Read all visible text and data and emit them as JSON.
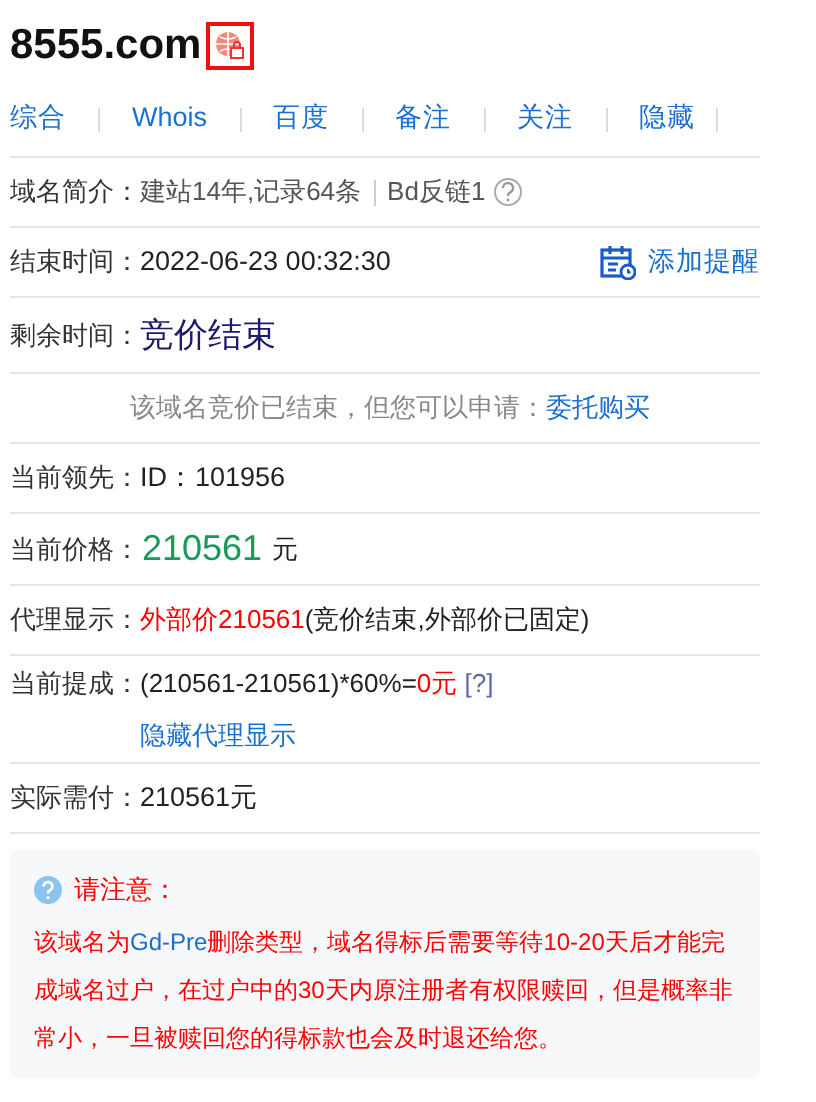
{
  "domain": {
    "name": "8555.com"
  },
  "nav": [
    "综合",
    "Whois",
    "百度",
    "备注",
    "关注",
    "隐藏"
  ],
  "rows": [
    {
      "kind": "intro",
      "label": "域名简介：",
      "value": "建站14年,记录64条",
      "extra": "Bd反链1"
    },
    {
      "kind": "end",
      "label": "结束时间：",
      "value": "2022-06-23 00:32:30",
      "action": "添加提醒"
    },
    {
      "kind": "big",
      "label": "剩余时间：",
      "value": "竞价结束"
    },
    {
      "kind": "note",
      "segments": [
        {
          "kind": "muted",
          "text": "该域名竞价已结束，但您可以申请："
        },
        {
          "kind": "link",
          "text": "委托购买"
        }
      ]
    },
    {
      "kind": "plain",
      "label": "当前领先：",
      "value": "ID：101956"
    },
    {
      "kind": "price",
      "label": "当前价格：",
      "value": "210561",
      "unit": "元"
    },
    {
      "kind": "segments",
      "label": "代理显示：",
      "segments": [
        {
          "kind": "red",
          "text": "外部价210561"
        },
        {
          "kind": "normal",
          "text": "(竞价结束,外部价已固定)"
        }
      ]
    },
    {
      "kind": "segments",
      "label": "当前提成：",
      "segments": [
        {
          "kind": "normal",
          "text": "(210561-210561)*60%="
        },
        {
          "kind": "red",
          "text": "0元"
        },
        {
          "kind": "help",
          "text": " [?]"
        }
      ],
      "link": "隐藏代理显示"
    },
    {
      "kind": "plain",
      "label": "实际需付：",
      "value": "210561元"
    }
  ],
  "notice": {
    "title": "请注意：",
    "segments": [
      {
        "kind": "red",
        "text": "该域名为"
      },
      {
        "kind": "link",
        "text": "Gd-Pre"
      },
      {
        "kind": "red",
        "text": "删除类型，域名得标后需要等待10-20天后才能完成域名过户，在过户中的30天内原注册者有权限赎回，但是概率非常小，一旦被赎回您的得标款也会及时退还给您。"
      }
    ]
  }
}
